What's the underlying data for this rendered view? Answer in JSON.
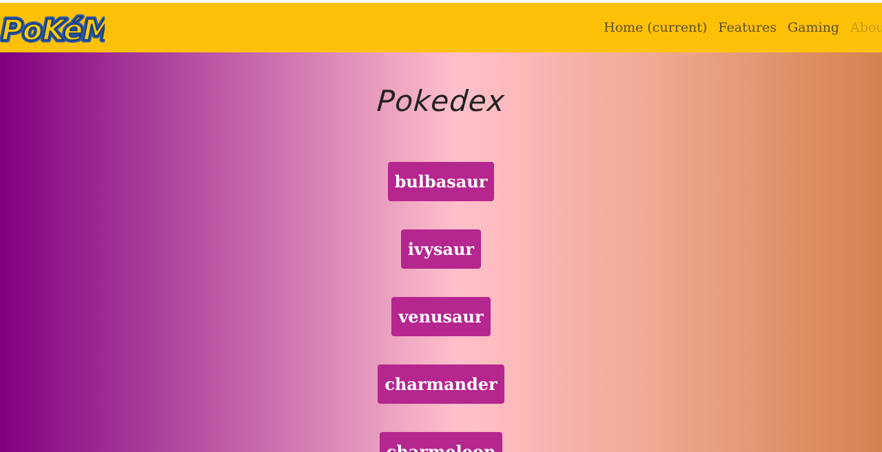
{
  "navbar": {
    "brand_alt": "Pokémon",
    "links": [
      {
        "label": "Home (current)"
      },
      {
        "label": "Features"
      },
      {
        "label": "Gaming"
      },
      {
        "label": "About"
      }
    ],
    "background_color": "#ffc107"
  },
  "main": {
    "title": "Pokedex",
    "pokemon": [
      {
        "name": "bulbasaur"
      },
      {
        "name": "ivysaur"
      },
      {
        "name": "venusaur"
      },
      {
        "name": "charmander"
      },
      {
        "name": "charmeleon"
      }
    ],
    "button_color": "#b5268f"
  },
  "colors": {
    "gradient": [
      "#800080",
      "#c96cae",
      "#ffc0cb",
      "#efa890",
      "#d4824e"
    ]
  }
}
